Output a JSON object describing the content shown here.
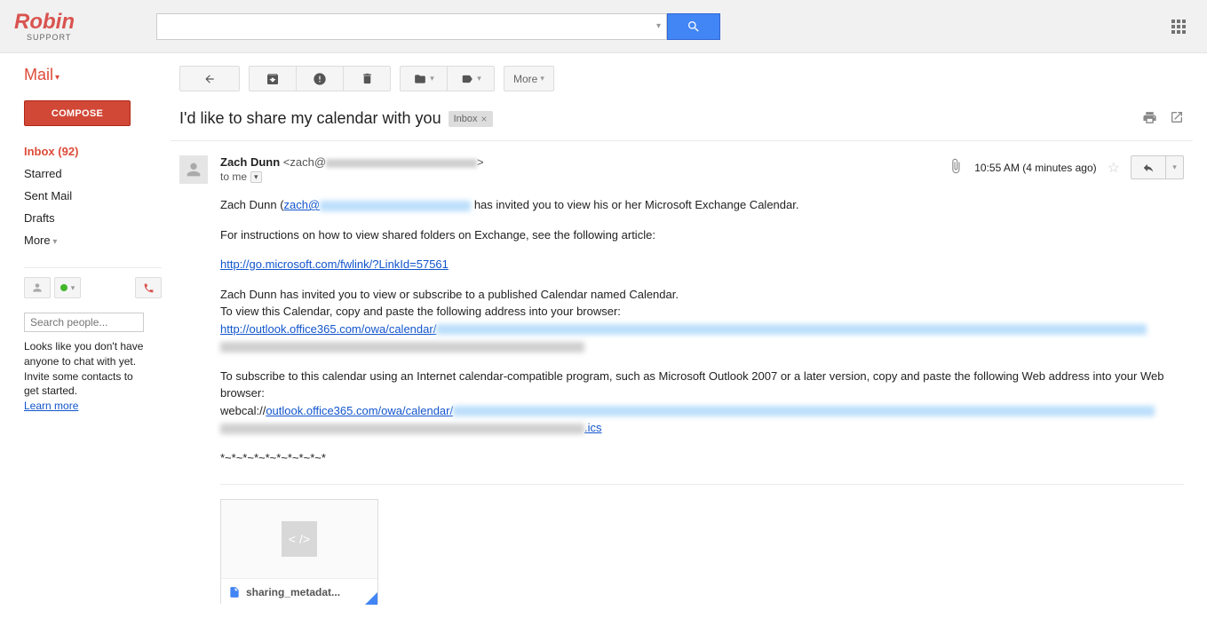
{
  "logo": {
    "text": "Robin",
    "sub": "SUPPORT"
  },
  "search": {
    "placeholder": ""
  },
  "sidebar": {
    "mail_label": "Mail",
    "compose": "COMPOSE",
    "items": [
      {
        "label": "Inbox (92)",
        "active": true
      },
      {
        "label": "Starred"
      },
      {
        "label": "Sent Mail"
      },
      {
        "label": "Drafts"
      }
    ],
    "more": "More",
    "search_people_placeholder": "Search people...",
    "chat_text": "Looks like you don't have anyone to chat with yet. Invite some contacts to get started.",
    "learn_more": "Learn more"
  },
  "toolbar": {
    "more": "More"
  },
  "subject": {
    "text": "I'd like to share my calendar with you",
    "label": "Inbox"
  },
  "email": {
    "sender_name": "Zach Dunn",
    "sender_prefix": "<zach@",
    "sender_suffix": ">",
    "to": "to me",
    "time": "10:55 AM (4 minutes ago)",
    "body": {
      "l1a": "Zach Dunn (",
      "l1b": "zach@",
      "l1c": " has invited you to view his or her Microsoft Exchange Calendar.",
      "l2": "For instructions on how to view shared folders on Exchange, see the following article:",
      "link1": "http://go.microsoft.com/fwlink/?LinkId=57561",
      "l3": "Zach Dunn has invited you to view or subscribe to a published Calendar named Calendar.",
      "l4": "To view this Calendar, copy and paste the following address into your browser:",
      "link2": "http://outlook.office365.com/owa/calendar/",
      "l5": "To subscribe to this calendar using an Internet calendar-compatible program, such as Microsoft Outlook 2007 or a later version, copy and paste the following Web address into your Web browser:",
      "l6a": "webcal://",
      "l6b": "outlook.office365.com/owa/calendar/",
      "l6c": ".ics",
      "sig": "*~*~*~*~*~*~*~*~*~*"
    },
    "attachment": {
      "preview": "< />",
      "name": "sharing_metadat..."
    }
  }
}
